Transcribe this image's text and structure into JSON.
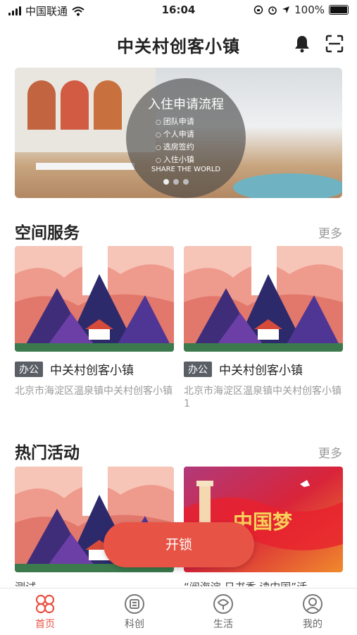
{
  "status_bar": {
    "carrier": "中国联通",
    "time": "16:04",
    "battery": "100%"
  },
  "header": {
    "title": "中关村创客小镇"
  },
  "banner": {
    "title": "入住申请流程",
    "steps": [
      "团队申请",
      "个人申请",
      "选房签约",
      "入住小镇"
    ],
    "subtitle": "SHARE THE WORLD"
  },
  "space_section": {
    "title": "空间服务",
    "more": "更多",
    "cards": [
      {
        "tag": "办公",
        "name": "中关村创客小镇",
        "address": "北京市海淀区温泉镇中关村创客小镇"
      },
      {
        "tag": "办公",
        "name": "中关村创客小镇",
        "address": "北京市海淀区温泉镇中关村创客小镇1"
      }
    ]
  },
  "activity_section": {
    "title": "热门活动",
    "more": "更多",
    "cards": [
      {
        "title": "测试"
      },
      {
        "title": "“阅海淀 日书香 读中国”活",
        "image_text": "中国梦"
      }
    ]
  },
  "unlock_button": "开锁",
  "tabbar": [
    {
      "label": "首页",
      "icon": "home-grid-icon",
      "active": true
    },
    {
      "label": "科创",
      "icon": "science-icon",
      "active": false
    },
    {
      "label": "生活",
      "icon": "life-icon",
      "active": false
    },
    {
      "label": "我的",
      "icon": "profile-icon",
      "active": false
    }
  ],
  "colors": {
    "accent": "#e75445",
    "tag_bg": "#5a5f66"
  }
}
